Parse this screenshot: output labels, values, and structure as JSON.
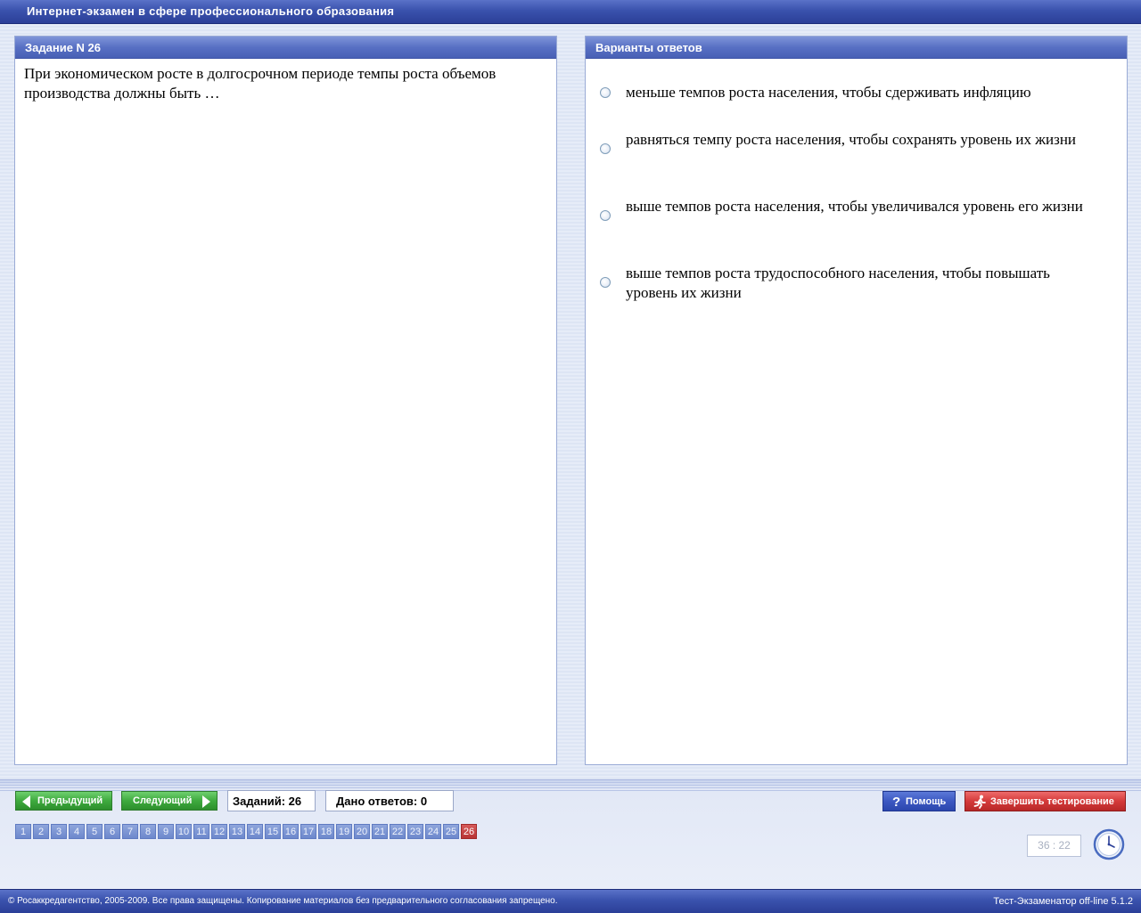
{
  "app": {
    "title": "Интернет-экзамен в сфере профессионального образования"
  },
  "task": {
    "header": "Задание N 26",
    "question": "При экономическом росте в долгосрочном периоде темпы роста объемов производства должны быть …"
  },
  "answers": {
    "header": "Варианты ответов",
    "options": [
      {
        "label": "меньше темпов роста населения, чтобы сдерживать инфляцию",
        "selected": false
      },
      {
        "label": "равняться темпу роста населения, чтобы сохранять уровень их жизни",
        "selected": false
      },
      {
        "label": "выше темпов роста населения, чтобы увеличивался уровень его жизни",
        "selected": false
      },
      {
        "label": "выше темпов роста трудоспособного населения, чтобы повышать уровень их жизни",
        "selected": false
      }
    ]
  },
  "nav": {
    "prev_label": "Предыдущий",
    "next_label": "Следующий",
    "tasks_count": "Заданий: 26",
    "answers_given": "Дано ответов: 0",
    "help_label": "Помощь",
    "finish_label": "Завершить тестирование",
    "questions": [
      "1",
      "2",
      "3",
      "4",
      "5",
      "6",
      "7",
      "8",
      "9",
      "10",
      "11",
      "12",
      "13",
      "14",
      "15",
      "16",
      "17",
      "18",
      "19",
      "20",
      "21",
      "22",
      "23",
      "24",
      "25",
      "26"
    ],
    "current_question": "26"
  },
  "timer": {
    "value": "36 : 22"
  },
  "footer": {
    "copyright": "© Росаккредагентство, 2005-2009. Все права защищены. Копирование материалов без предварительного согласования запрещено.",
    "version": "Тест-Экзаменатор off-line 5.1.2"
  },
  "colors": {
    "bar_blue": "#3a52ad",
    "nav_green": "#3faa3f",
    "finish_red": "#d43a3a",
    "current_question_red": "#b83434"
  },
  "icons": {
    "help": "question-icon",
    "finish": "running-man-icon",
    "timer": "clock-icon",
    "prev": "arrow-left-icon",
    "next": "arrow-right-icon",
    "option": "radio-icon"
  }
}
